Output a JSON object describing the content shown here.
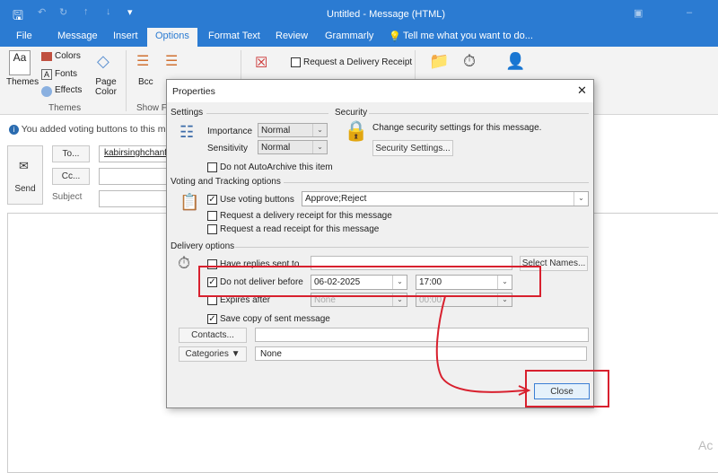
{
  "window": {
    "title": "Untitled - Message (HTML)"
  },
  "tabs": [
    {
      "label": "File"
    },
    {
      "label": "Message"
    },
    {
      "label": "Insert"
    },
    {
      "label": "Options"
    },
    {
      "label": "Format Text"
    },
    {
      "label": "Review"
    },
    {
      "label": "Grammarly"
    }
  ],
  "tell_me": "Tell me what you want to do...",
  "ribbon": {
    "themes": "Themes",
    "colors": "Colors",
    "fonts": "Fonts",
    "effects": "Effects",
    "page_color": "Page Color",
    "themes_group": "Themes",
    "bcc": "Bcc",
    "show_group": "Show F",
    "delivery_receipt": "Request a Delivery Receipt"
  },
  "infobar": "You added voting buttons to this me",
  "compose": {
    "send": "Send",
    "to": "To...",
    "cc": "Cc...",
    "subject": "Subject",
    "to_value": "kabirsinghchanfi@"
  },
  "dialog": {
    "title": "Properties",
    "settings": "Settings",
    "security": "Security",
    "importance_label": "Importance",
    "importance": "Normal",
    "sensitivity_label": "Sensitivity",
    "sensitivity": "Normal",
    "autoarchive": "Do not AutoArchive this item",
    "security_text": "Change security settings for this message.",
    "security_btn": "Security Settings...",
    "voting_section": "Voting and Tracking options",
    "use_voting": "Use voting buttons",
    "voting_value": "Approve;Reject",
    "delivery_receipt": "Request a delivery receipt for this message",
    "read_receipt": "Request a read receipt for this message",
    "delivery_section": "Delivery options",
    "replies": "Have replies sent to",
    "select_names": "Select Names...",
    "dnd_before": "Do not deliver before",
    "dnd_date": "06-02-2025",
    "dnd_time": "17:00",
    "expires": "Expires after",
    "expires_date": "None",
    "expires_time": "00:00",
    "save_copy": "Save copy of sent message",
    "contacts": "Contacts...",
    "categories": "Categories",
    "categories_value": "None",
    "close": "Close"
  },
  "watermark": "Ac",
  "colors": {
    "accent": "#2b7bd2",
    "annotation": "#d8202e"
  }
}
